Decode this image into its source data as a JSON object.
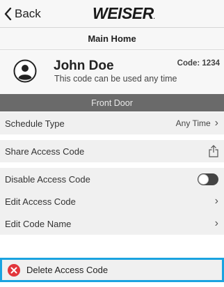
{
  "navbar": {
    "back_label": "Back",
    "logo_text": "WEISER",
    "logo_dot": "."
  },
  "header": {
    "title": "Main Home"
  },
  "user": {
    "name": "John Doe",
    "subtitle": "This code can be used any time",
    "code": "Code: 1234"
  },
  "section": {
    "title": "Front Door"
  },
  "rows": [
    {
      "label": "Schedule Type",
      "value": "Any Time",
      "accessory": "chevron-right-icon"
    },
    {
      "label": "Share Access Code",
      "accessory": "share-icon"
    },
    {
      "label": "Disable Access Code",
      "accessory": "toggle",
      "toggle_on": false
    },
    {
      "label": "Edit Access Code",
      "accessory": "chevron-right-icon"
    },
    {
      "label": "Edit Code Name",
      "accessory": "chevron-right-icon"
    }
  ],
  "delete": {
    "label": "Delete Access Code",
    "icon": "delete-x-icon"
  },
  "colors": {
    "section_bar": "#6a6a6a",
    "highlight_border": "#1aa3e0",
    "delete_icon": "#e2353b"
  }
}
